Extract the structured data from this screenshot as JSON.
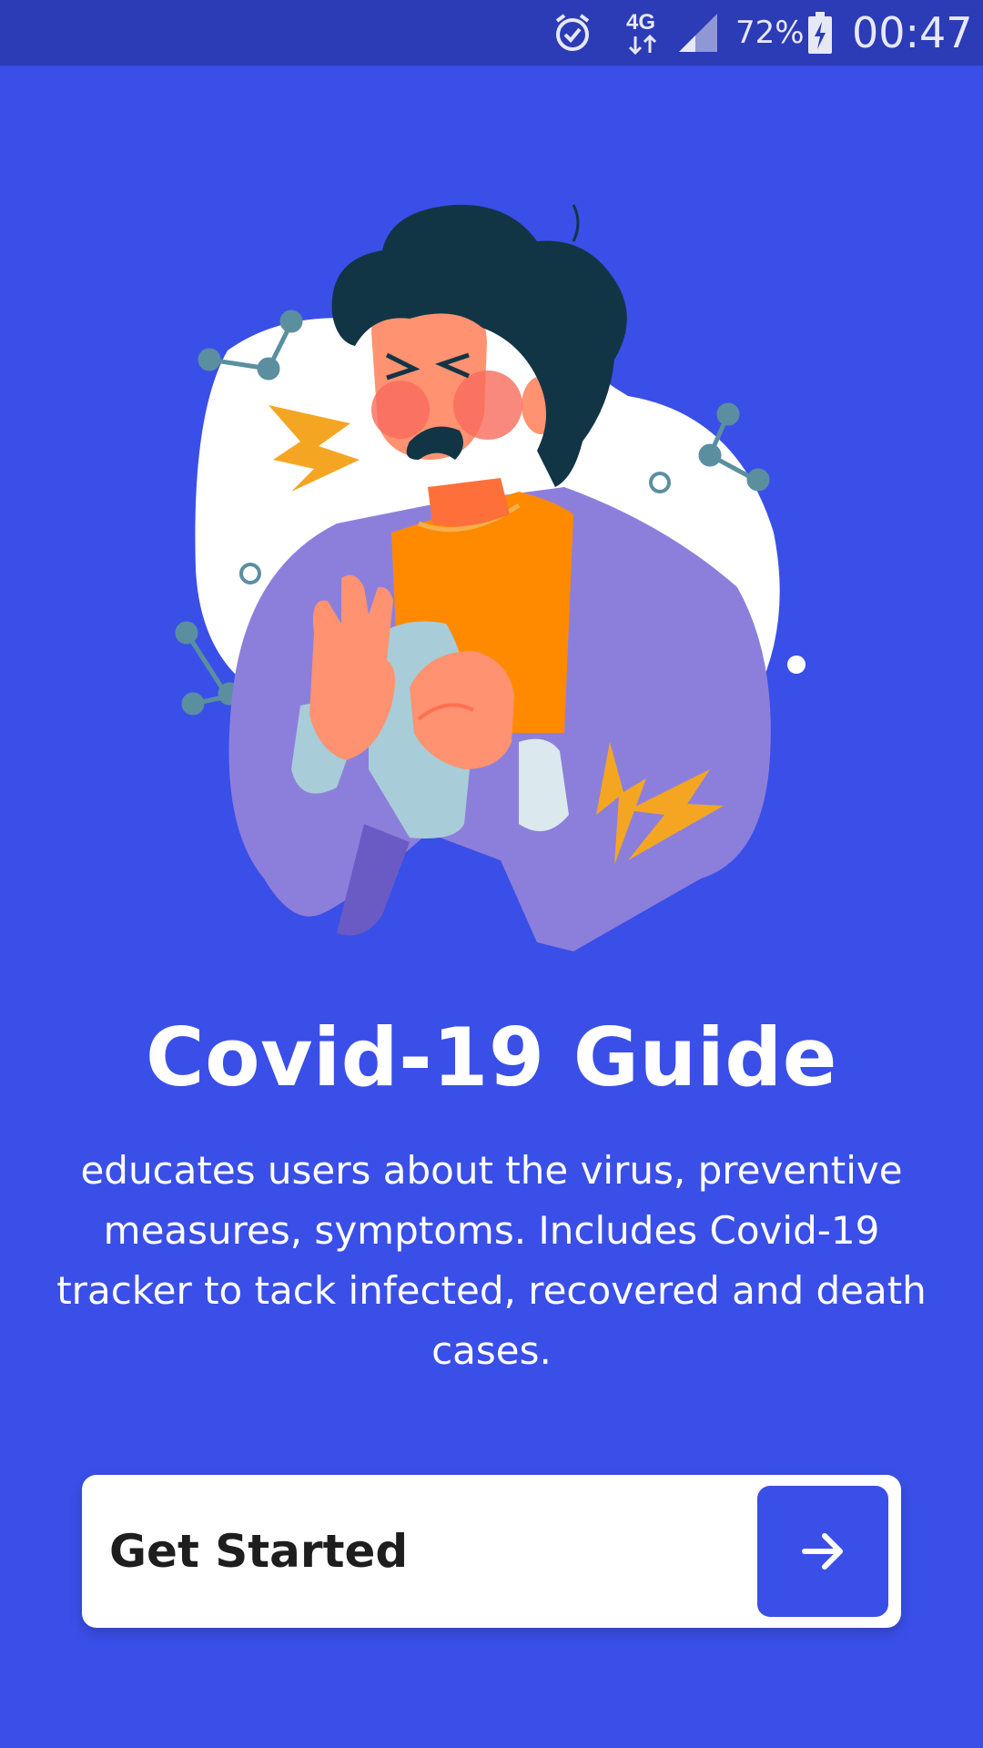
{
  "status_bar": {
    "network": "4G",
    "battery_percent": "72%",
    "time": "00:47",
    "icons": [
      "alarm-icon",
      "network-4g-icon",
      "signal-icon",
      "battery-charging-icon"
    ]
  },
  "hero": {
    "title": "Covid-19 Guide",
    "description": "educates users about the virus, preventive measures, symptoms. Includes Covid-19 tracker to tack infected, recovered and death cases."
  },
  "cta": {
    "label": "Get Started",
    "icon": "arrow-right-icon"
  },
  "colors": {
    "background": "#3a4fe8",
    "status_bar": "#2c3bb6",
    "button_background": "#ffffff",
    "accent": "#3a4fe8"
  }
}
